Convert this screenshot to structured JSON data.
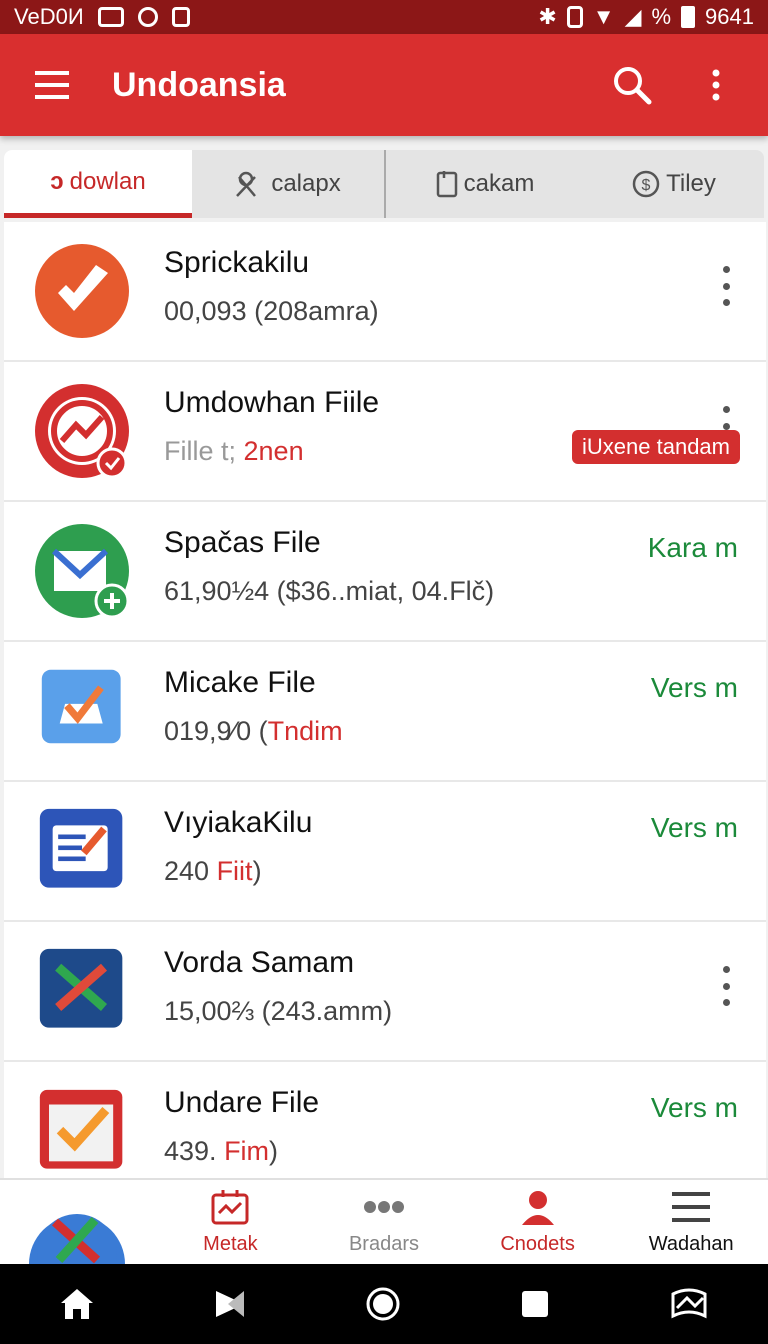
{
  "status_bar": {
    "carrier": "VeD0И",
    "battery_pct": "%",
    "time": "9641"
  },
  "app_bar": {
    "title": "Undoansia"
  },
  "tabs": [
    {
      "label": "dowlan",
      "prefix": "ↄ"
    },
    {
      "label": "calapx"
    },
    {
      "label": "cakam"
    },
    {
      "label": "Tiley"
    }
  ],
  "files": [
    {
      "name": "Sprickakilu",
      "sub_a": "00,093 (208amra)",
      "sub_b": "",
      "sub_c": "",
      "action": "",
      "icon": "orange-circle-tag-icon",
      "color": "#e65a2e"
    },
    {
      "name": "Umdowhan Fiile",
      "sub_a": "",
      "sub_grey": "Fille t;",
      "sub_b": " 2nen",
      "sub_c": "",
      "action": "",
      "badge": "iUxene tandam",
      "icon": "red-chart-icon",
      "color": "#d32f2f"
    },
    {
      "name": "Spačas File",
      "sub_a": "61,90½4 ($36..miat, 04.Flč)",
      "sub_b": "",
      "sub_c": "",
      "action": "Kara m",
      "icon": "green-mail-icon",
      "color": "#2e9e4f"
    },
    {
      "name": "Micake File",
      "sub_a": "019,9⁄0 (",
      "sub_b": "Tndim",
      "sub_c": "",
      "action": "Vers m",
      "icon": "blue-check-icon",
      "color": "#4a90e2"
    },
    {
      "name": "VıyiakaKilu",
      "sub_a": "240 ",
      "sub_b": "Fiit",
      "sub_c": ")",
      "action": "Vers m",
      "icon": "blue-list-icon",
      "color": "#2d55b8"
    },
    {
      "name": "Vorda Samam",
      "sub_a": "15,00⅔ (243.amm)",
      "sub_b": "",
      "sub_c": "",
      "action": "",
      "icon": "navy-x-icon",
      "color": "#1e4a8a"
    },
    {
      "name": "Undare File",
      "sub_a": "439. ",
      "sub_b": "Fim",
      "sub_c": ")",
      "action": "Vers m",
      "icon": "red-check-icon",
      "color": "#d32f2f"
    }
  ],
  "bottom_nav": [
    {
      "label": "",
      "icon": "app-logo-icon"
    },
    {
      "label": "Metak",
      "icon": "calendar-chart-icon"
    },
    {
      "label": "Bradars",
      "icon": "dots-icon"
    },
    {
      "label": "Cnodets",
      "icon": "person-icon"
    },
    {
      "label": "Wadahan",
      "icon": "hamburger-icon"
    }
  ],
  "colors": {
    "primary": "#d92f2f",
    "status": "#8c1717",
    "accent_green": "#1b8a3a"
  }
}
